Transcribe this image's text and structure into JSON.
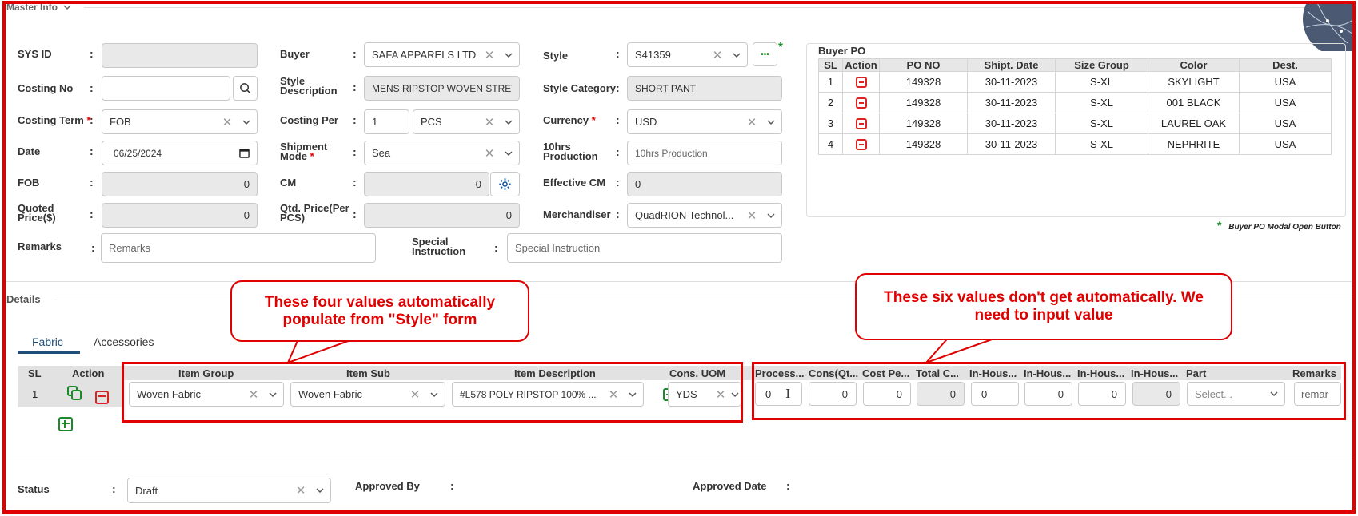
{
  "master": {
    "section_title": "Master Info",
    "sys_id": {
      "label": "SYS ID",
      "value": ""
    },
    "costing_no": {
      "label": "Costing No",
      "value": ""
    },
    "costing_term": {
      "label": "Costing Term",
      "value": "FOB"
    },
    "date": {
      "label": "Date",
      "value": "06/25/2024"
    },
    "fob": {
      "label": "FOB",
      "value": "0"
    },
    "quoted_price": {
      "label_line1": "Quoted",
      "label_line2": "Price($)",
      "value": "0"
    },
    "remarks": {
      "label": "Remarks",
      "placeholder": "Remarks"
    },
    "buyer": {
      "label": "Buyer",
      "value": "SAFA APPARELS LTD"
    },
    "style_description": {
      "label_line1": "Style",
      "label_line2": "Description",
      "value": "MENS RIPSTOP WOVEN STRETC"
    },
    "costing_per": {
      "label": "Costing Per",
      "qty": "1",
      "unit": "PCS"
    },
    "shipment_mode": {
      "label_line1": "Shipment",
      "label_line2": "Mode",
      "value": "Sea"
    },
    "cm": {
      "label": "CM",
      "value": "0"
    },
    "qtd_price": {
      "label_line1": "Qtd. Price(Per",
      "label_line2": "PCS)",
      "value": "0"
    },
    "special_instruction": {
      "label_line1": "Special",
      "label_line2": "Instruction",
      "placeholder": "Special Instruction"
    },
    "style": {
      "label": "Style",
      "value": "S41359",
      "more": "•••"
    },
    "style_category": {
      "label": "Style Category",
      "value": "SHORT PANT"
    },
    "currency": {
      "label": "Currency",
      "value": "USD"
    },
    "production_10hrs": {
      "label_line1": "10hrs",
      "label_line2": "Production",
      "placeholder": "10hrs Production"
    },
    "effective_cm": {
      "label": "Effective CM",
      "value": "0"
    },
    "merchandiser": {
      "label": "Merchandiser",
      "value": "QuadRION Technol..."
    },
    "asterisk": "*",
    "colon": ":"
  },
  "buyer_po": {
    "title": "Buyer PO",
    "columns": [
      "SL",
      "Action",
      "PO NO",
      "Shipt. Date",
      "Size Group",
      "Color",
      "Dest."
    ],
    "rows": [
      {
        "sl": "1",
        "po": "149328",
        "date": "30-11-2023",
        "size": "S-XL",
        "color": "SKYLIGHT",
        "dest": "USA"
      },
      {
        "sl": "2",
        "po": "149328",
        "date": "30-11-2023",
        "size": "S-XL",
        "color": "001 BLACK",
        "dest": "USA"
      },
      {
        "sl": "3",
        "po": "149328",
        "date": "30-11-2023",
        "size": "S-XL",
        "color": "LAUREL OAK",
        "dest": "USA"
      },
      {
        "sl": "4",
        "po": "149328",
        "date": "30-11-2023",
        "size": "S-XL",
        "color": "NEPHRITE",
        "dest": "USA"
      }
    ],
    "note_star": "*",
    "note": "Buyer PO Modal Open Button"
  },
  "details": {
    "section_title": "Details",
    "tabs": [
      "Fabric",
      "Accessories"
    ],
    "left_columns": [
      "SL",
      "Action",
      "Item Group",
      "Item Sub",
      "Item Description",
      "Cons. UOM"
    ],
    "right_columns": [
      "Process...",
      "Cons(Qt...",
      "Cost Pe...",
      "Total C...",
      "In-Hous...",
      "In-Hous...",
      "In-Hous...",
      "In-Hous...",
      "Part",
      "Remarks"
    ],
    "row": {
      "sl": "1",
      "item_group": "Woven Fabric",
      "item_sub": "Woven Fabric",
      "item_description": "#L578 POLY RIPSTOP 100% ...",
      "uom": "YDS",
      "process": "0",
      "cons": "0",
      "cost_per": "0",
      "total": "0",
      "inhouse1": "0",
      "inhouse2": "0",
      "inhouse3": "0",
      "inhouse4": "0",
      "part_placeholder": "Select...",
      "remarks": "remar"
    }
  },
  "callouts": {
    "left_line1": "These four values automatically",
    "left_line2": "populate from \"Style\" form",
    "right_line1": "These six values don't get automatically. We",
    "right_line2": "need to input value"
  },
  "footer": {
    "status_label": "Status",
    "status_value": "Draft",
    "approved_by_label": "Approved By",
    "approved_date_label": "Approved Date"
  },
  "colors": {
    "annotation_red": "#e00000",
    "add_green": "#1a8a2a",
    "tab_blue": "#1f4e79"
  }
}
